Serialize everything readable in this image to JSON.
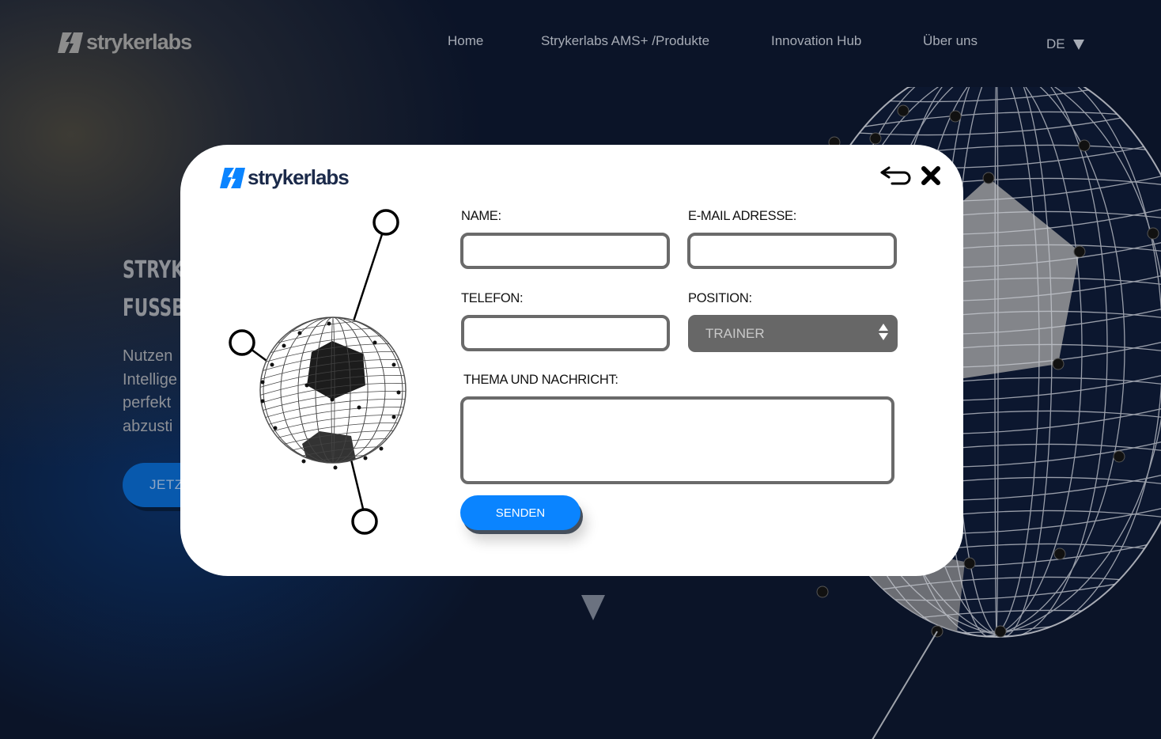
{
  "header": {
    "brand": "strykerlabs",
    "nav": [
      {
        "label": "Home"
      },
      {
        "label": "Strykerlabs AMS+ /Produkte"
      },
      {
        "label": "Innovation Hub"
      },
      {
        "label": "Über uns"
      }
    ],
    "language": "DE"
  },
  "hero": {
    "title_line1": "STRYK",
    "title_line2": "FUSSB",
    "subtitle_lines": [
      "Nutzen",
      "Intellige",
      "perfekt",
      "abzusti"
    ],
    "cta_label": "JETZ"
  },
  "modal": {
    "brand": "strykerlabs",
    "colors": {
      "brand_blue": "#0a84ff",
      "brand_navy": "#1b2a4a"
    },
    "fields": {
      "name": {
        "label": "NAME:",
        "value": "",
        "placeholder": ""
      },
      "email": {
        "label": "E-MAIL ADRESSE:",
        "value": "",
        "placeholder": ""
      },
      "phone": {
        "label": "TELEFON:",
        "value": "",
        "placeholder": ""
      },
      "position": {
        "label": "POSITION:",
        "selected": "TRAINER"
      },
      "message": {
        "label": "THEMA UND NACHRICHT:",
        "value": "",
        "placeholder": ""
      }
    },
    "submit_label": "SENDEN"
  }
}
